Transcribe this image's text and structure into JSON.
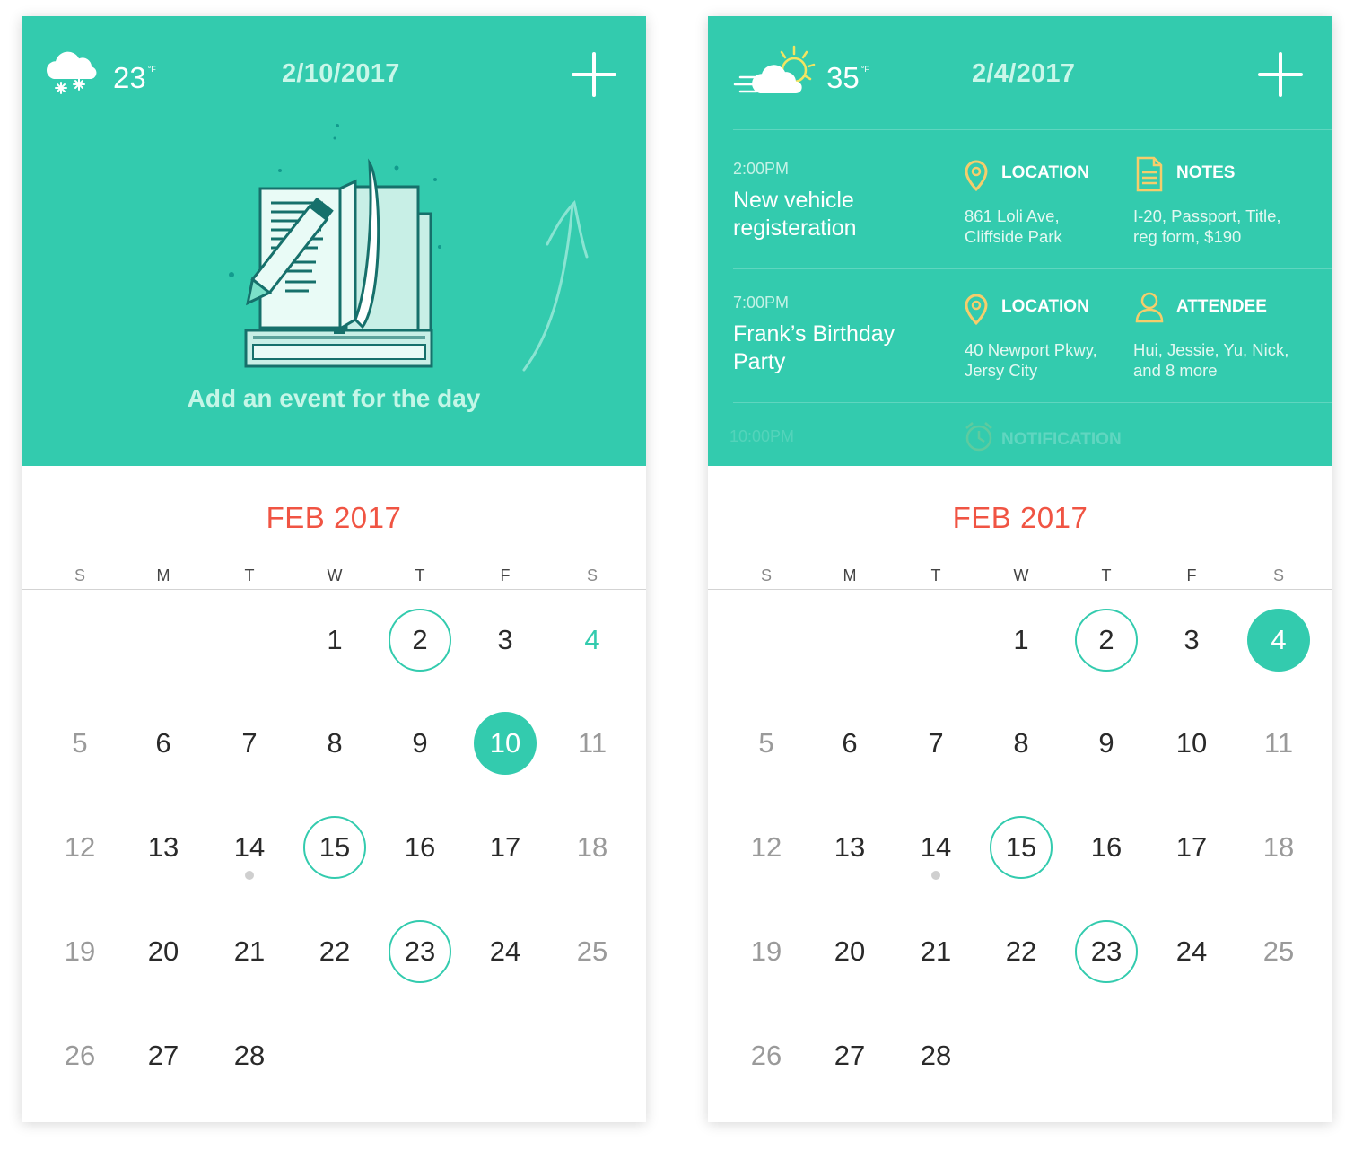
{
  "colors": {
    "teal": "#33cbae",
    "month_red": "#f05443",
    "event_icon_yellow": "#f6cd6b"
  },
  "left": {
    "weather": {
      "icon": "snow-cloud-icon",
      "temp": "23",
      "unit": "°F"
    },
    "date": "2/10/2017",
    "add_icon": "plus-icon",
    "illustration": "notebook-pencil-illustration",
    "empty_message": "Add an event for the day"
  },
  "right": {
    "weather": {
      "icon": "windy-partly-sunny-icon",
      "temp": "35",
      "unit": "°F"
    },
    "date": "2/4/2017",
    "add_icon": "plus-icon",
    "events": [
      {
        "time": "2:00PM",
        "title": "New vehicle registeration",
        "col1": {
          "icon": "location-pin-icon",
          "label": "LOCATION",
          "lines": [
            "861 Loli Ave,",
            "Cliffside Park"
          ]
        },
        "col2": {
          "icon": "notes-document-icon",
          "label": "NOTES",
          "lines": [
            "I-20, Passport, Title,",
            "reg form, $190"
          ]
        }
      },
      {
        "time": "7:00PM",
        "title": "Frank’s Birthday Party",
        "col1": {
          "icon": "location-pin-icon",
          "label": "LOCATION",
          "lines": [
            "40 Newport Pkwy,",
            "Jersy City"
          ]
        },
        "col2": {
          "icon": "person-attendee-icon",
          "label": "ATTENDEE",
          "lines": [
            "Hui, Jessie, Yu, Nick,",
            "and 8 more"
          ]
        }
      },
      {
        "time": "10:00PM",
        "title": "",
        "col1": {
          "icon": "alarm-clock-icon",
          "label": "NOTIFICATION",
          "lines": []
        }
      }
    ]
  },
  "calendar": {
    "month_label": "FEB 2017",
    "weekdays": [
      "S",
      "M",
      "T",
      "W",
      "T",
      "F",
      "S"
    ],
    "first_weekday_index": 3,
    "days_in_month": 28,
    "left_marks": {
      "ring": [
        2,
        15,
        23
      ],
      "filled": [
        10
      ],
      "accent": [
        4
      ],
      "dot": [
        14
      ]
    },
    "right_marks": {
      "ring": [
        2,
        15,
        23
      ],
      "filled": [
        4
      ],
      "accent": [],
      "dot": [
        14
      ]
    }
  }
}
